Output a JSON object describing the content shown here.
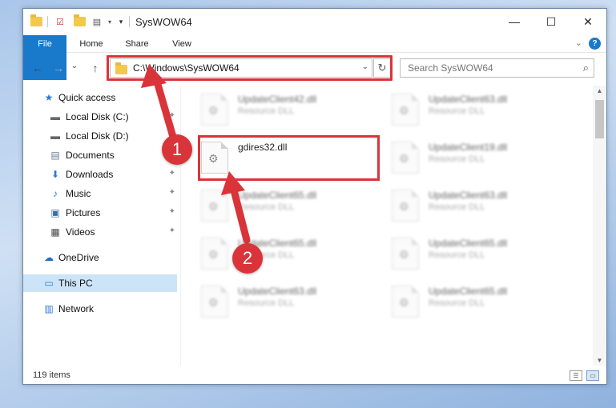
{
  "window": {
    "title": "SysWOW64",
    "minimize_icon": "—",
    "maximize_icon": "☐",
    "close_icon": "✕"
  },
  "ribbon": {
    "tabs": [
      "File",
      "Home",
      "Share",
      "View"
    ],
    "expand_icon": "⌄",
    "help_icon": "?"
  },
  "nav": {
    "back_icon": "←",
    "forward_icon": "→",
    "history_icon": "⌄",
    "up_icon": "↑",
    "address": "C:\\Windows\\SysWOW64",
    "address_dropdown_icon": "⌄",
    "refresh_icon": "↻",
    "search_placeholder": "Search SysWOW64",
    "search_icon": "⌕"
  },
  "sidebar": {
    "items": [
      {
        "label": "Quick access",
        "icon": "★",
        "pinned": false
      },
      {
        "label": "Local Disk (C:)",
        "icon": "▬",
        "pinned": true
      },
      {
        "label": "Local Disk (D:)",
        "icon": "▬",
        "pinned": false
      },
      {
        "label": "Documents",
        "icon": "▤",
        "pinned": true
      },
      {
        "label": "Downloads",
        "icon": "⬇",
        "pinned": true
      },
      {
        "label": "Music",
        "icon": "♪",
        "pinned": true
      },
      {
        "label": "Pictures",
        "icon": "▣",
        "pinned": true
      },
      {
        "label": "Videos",
        "icon": "▦",
        "pinned": true
      },
      {
        "label": "OneDrive",
        "icon": "☁",
        "pinned": false
      },
      {
        "label": "This PC",
        "icon": "▭",
        "pinned": false
      },
      {
        "label": "Network",
        "icon": "▥",
        "pinned": false
      }
    ],
    "pin_icon": "📌"
  },
  "files": [
    {
      "name": "UpdateClient42.dll",
      "type": "Resource DLL"
    },
    {
      "name": "UpdateClient63.dll",
      "type": "Resource DLL"
    },
    {
      "name": "gdires32.dll",
      "type": ""
    },
    {
      "name": "UpdateClient19.dll",
      "type": "Resource DLL"
    },
    {
      "name": "UpdateClient65.dll",
      "type": "Resource DLL"
    },
    {
      "name": "UpdateClient63.dll",
      "type": "Resource DLL"
    },
    {
      "name": "UpdateClient65.dll",
      "type": "Resource DLL"
    },
    {
      "name": "UpdateClient65.dll",
      "type": "Resource DLL"
    },
    {
      "name": "UpdateClient63.dll",
      "type": "Resource DLL"
    },
    {
      "name": "UpdateClient65.dll",
      "type": "Resource DLL"
    }
  ],
  "status": {
    "item_count": "119 items"
  },
  "annotations": {
    "step1": "1",
    "step2": "2",
    "color": "#d9343a"
  }
}
